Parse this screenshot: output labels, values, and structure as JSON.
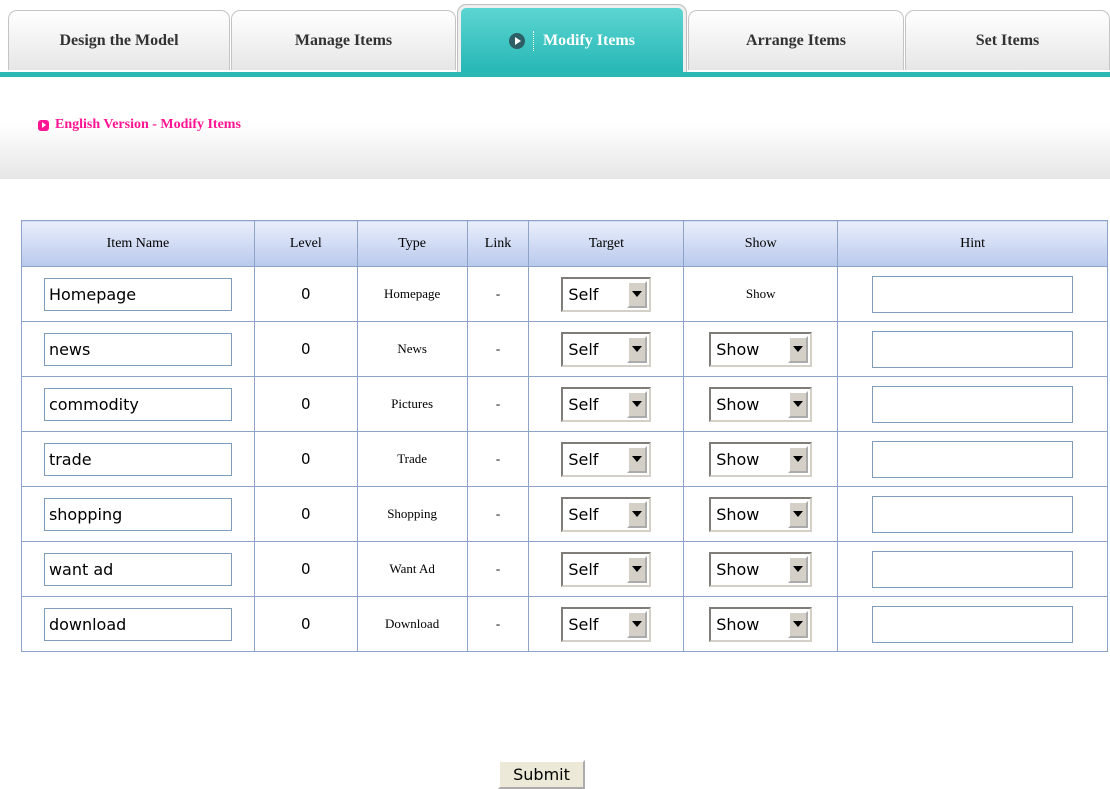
{
  "tabs": [
    {
      "label": "Design the Model",
      "active": false
    },
    {
      "label": "Manage Items",
      "active": false
    },
    {
      "label": "Modify Items",
      "active": true
    },
    {
      "label": "Arrange Items",
      "active": false
    },
    {
      "label": "Set Items",
      "active": false
    }
  ],
  "section": {
    "title": "English Version - Modify Items"
  },
  "table": {
    "headers": [
      "Item Name",
      "Level",
      "Type",
      "Link",
      "Target",
      "Show",
      "Hint"
    ],
    "rows": [
      {
        "name": "Homepage",
        "level": "0",
        "type": "Homepage",
        "link": "-",
        "target": "Self",
        "show": "Show",
        "show_editable": false,
        "hint": ""
      },
      {
        "name": "news",
        "level": "0",
        "type": "News",
        "link": "-",
        "target": "Self",
        "show": "Show",
        "show_editable": true,
        "hint": ""
      },
      {
        "name": "commodity",
        "level": "0",
        "type": "Pictures",
        "link": "-",
        "target": "Self",
        "show": "Show",
        "show_editable": true,
        "hint": ""
      },
      {
        "name": "trade",
        "level": "0",
        "type": "Trade",
        "link": "-",
        "target": "Self",
        "show": "Show",
        "show_editable": true,
        "hint": ""
      },
      {
        "name": "shopping",
        "level": "0",
        "type": "Shopping",
        "link": "-",
        "target": "Self",
        "show": "Show",
        "show_editable": true,
        "hint": ""
      },
      {
        "name": "want ad",
        "level": "0",
        "type": "Want Ad",
        "link": "-",
        "target": "Self",
        "show": "Show",
        "show_editable": true,
        "hint": ""
      },
      {
        "name": "download",
        "level": "0",
        "type": "Download",
        "link": "-",
        "target": "Self",
        "show": "Show",
        "show_editable": true,
        "hint": ""
      }
    ]
  },
  "submit": {
    "label": "Submit"
  },
  "colors": {
    "accent_teal": "#2cb9b6",
    "title_pink": "#ff1493",
    "table_border": "#8da4c8",
    "header_bg": "#b9c9ec"
  },
  "icons": {
    "active_tab": "play-circle-icon",
    "section_title": "play-square-icon"
  }
}
